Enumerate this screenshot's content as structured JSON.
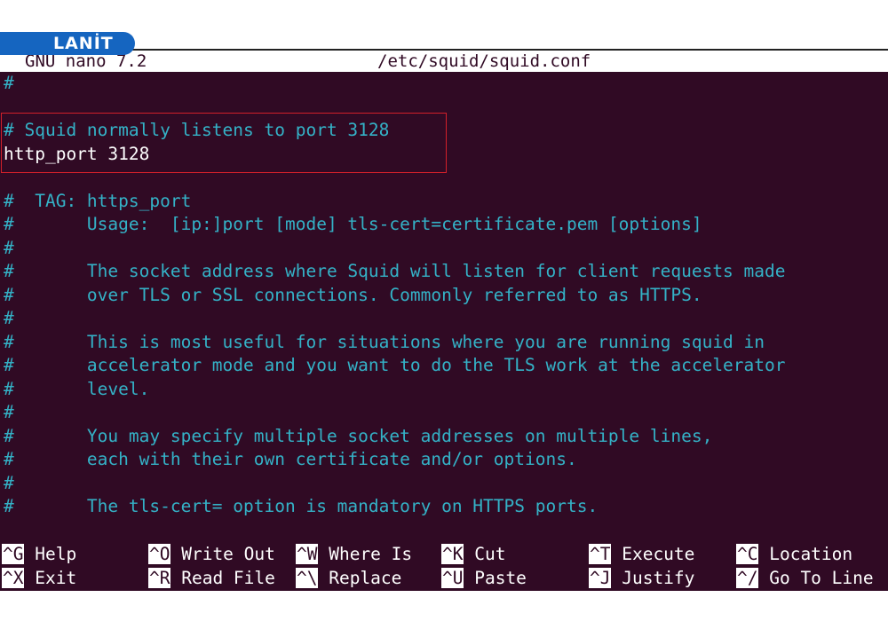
{
  "brand": {
    "logo_text": "LANİT"
  },
  "titlebar": {
    "version": "GNU nano 7.2",
    "filename": "/etc/squid/squid.conf"
  },
  "highlight_color": "#d3202a",
  "lines": [
    {
      "text": "#",
      "style": "comment"
    },
    {
      "text": "",
      "style": "comment"
    },
    {
      "text": "# Squid normally listens to port 3128",
      "style": "comment"
    },
    {
      "text": "http_port 3128",
      "style": "plain"
    },
    {
      "text": "",
      "style": "comment"
    },
    {
      "text": "#  TAG: https_port",
      "style": "comment"
    },
    {
      "text": "#       Usage:  [ip:]port [mode] tls-cert=certificate.pem [options]",
      "style": "comment"
    },
    {
      "text": "#",
      "style": "comment"
    },
    {
      "text": "#       The socket address where Squid will listen for client requests made",
      "style": "comment"
    },
    {
      "text": "#       over TLS or SSL connections. Commonly referred to as HTTPS.",
      "style": "comment"
    },
    {
      "text": "#",
      "style": "comment"
    },
    {
      "text": "#       This is most useful for situations where you are running squid in",
      "style": "comment"
    },
    {
      "text": "#       accelerator mode and you want to do the TLS work at the accelerator",
      "style": "comment"
    },
    {
      "text": "#       level.",
      "style": "comment"
    },
    {
      "text": "#",
      "style": "comment"
    },
    {
      "text": "#       You may specify multiple socket addresses on multiple lines,",
      "style": "comment"
    },
    {
      "text": "#       each with their own certificate and/or options.",
      "style": "comment"
    },
    {
      "text": "#",
      "style": "comment"
    },
    {
      "text": "#       The tls-cert= option is mandatory on HTTPS ports.",
      "style": "comment"
    }
  ],
  "shortcuts": {
    "row1": [
      {
        "key": "^G",
        "label": "Help"
      },
      {
        "key": "^O",
        "label": "Write Out"
      },
      {
        "key": "^W",
        "label": "Where Is"
      },
      {
        "key": "^K",
        "label": "Cut"
      },
      {
        "key": "^T",
        "label": "Execute"
      },
      {
        "key": "^C",
        "label": "Location"
      }
    ],
    "row2": [
      {
        "key": "^X",
        "label": "Exit"
      },
      {
        "key": "^R",
        "label": "Read File"
      },
      {
        "key": "^\\",
        "label": "Replace"
      },
      {
        "key": "^U",
        "label": "Paste"
      },
      {
        "key": "^J",
        "label": "Justify"
      },
      {
        "key": "^/",
        "label": "Go To Line"
      }
    ]
  }
}
